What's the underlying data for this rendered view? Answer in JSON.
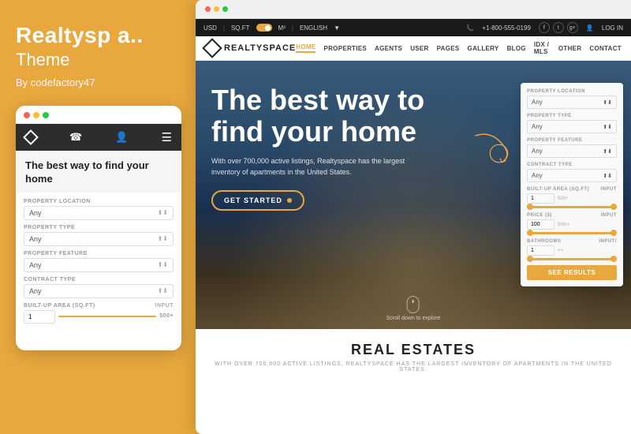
{
  "brand": {
    "name": "Realtysp a..",
    "subtitle": "Theme",
    "author": "By codefactory47"
  },
  "mobile": {
    "hero_text": "The best way to find your home",
    "nav_icons": [
      "◇",
      "☎",
      "👤",
      "☰"
    ],
    "form_fields": [
      {
        "label": "PROPERTY LOCATION",
        "value": "Any"
      },
      {
        "label": "PROPERTY TYPE",
        "value": "Any"
      },
      {
        "label": "PROPERTY FEATURE",
        "value": "Any"
      },
      {
        "label": "CONTRACT TYPE",
        "value": "Any"
      },
      {
        "label": "BUILT-UP AREA (SQ.FT)",
        "placeholder": "1",
        "input_label": "INPUT",
        "max_label": "500+"
      }
    ]
  },
  "desktop": {
    "topbar": {
      "usd": "USD",
      "sqft": "SQ.FT",
      "metric": "M²",
      "language": "ENGLISH",
      "phone": "+1-800-555-0199",
      "login": "LOG IN"
    },
    "nav": {
      "brand": "REALTYSPACE",
      "links": [
        "HOME",
        "PROPERTIES",
        "AGENTS",
        "USER",
        "PAGES",
        "GALLERY",
        "BLOG",
        "IDX / MLS",
        "OTHER",
        "CONTACT"
      ]
    },
    "hero": {
      "title": "The best way to find your home",
      "description": "With over 700,000 active listings, Realtyspace has the largest inventory of apartments in the United States.",
      "cta": "GET STARTED",
      "scroll_text": "Scroll down to explore"
    },
    "search_panel": {
      "fields": [
        {
          "label": "PROPERTY LOCATION",
          "value": "Any"
        },
        {
          "label": "PROPERTY TYPE",
          "value": "Any"
        },
        {
          "label": "PROPERTY FEATURE",
          "value": "Any"
        },
        {
          "label": "CONTRACT TYPE",
          "value": "Any"
        },
        {
          "label": "BUILT-UP AREA (SQ.FT)",
          "min": "1",
          "max": "500+",
          "input_label": "INPUT"
        },
        {
          "label": "PRICE ($)",
          "min": "100",
          "max": "50m+",
          "input_label": "INPUT"
        },
        {
          "label": "BATHROOMS",
          "min": "1",
          "max": "++",
          "input_label": "INPUT/"
        }
      ],
      "cta": "SEE RESULTS"
    },
    "real_estates": {
      "title": "REAL ESTATES",
      "description": "WITH OVER 700,000 ACTIVE LISTINGS, REALTYSPACE HAS THE LARGEST INVENTORY OF APARTMENTS IN THE UNITED STATES."
    }
  },
  "colors": {
    "primary": "#E8A83E",
    "dark": "#1a1a1a",
    "white": "#ffffff",
    "text_dark": "#222222",
    "text_gray": "#999999"
  }
}
